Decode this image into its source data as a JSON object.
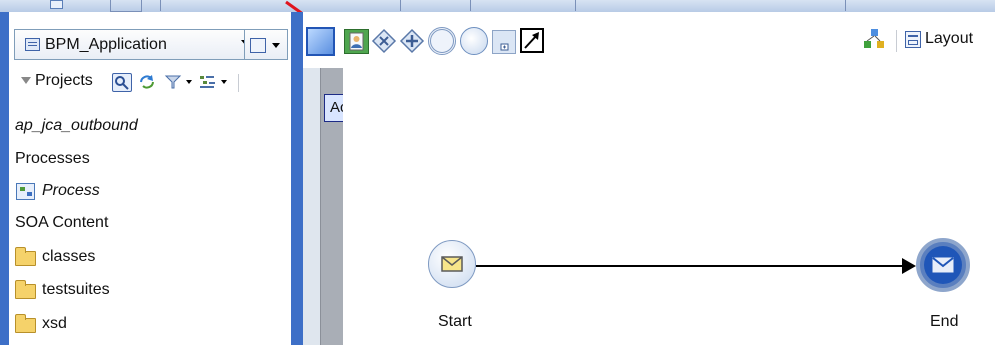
{
  "app_selector": {
    "value": "BPM_Application"
  },
  "projects": {
    "label": "Projects"
  },
  "tree": {
    "items": [
      {
        "label": "ap_jca_outbound",
        "kind": "project"
      },
      {
        "label": "Processes",
        "kind": "folder-header"
      },
      {
        "label": "Process",
        "kind": "process"
      },
      {
        "label": "SOA Content",
        "kind": "folder-header"
      },
      {
        "label": "classes",
        "kind": "folder"
      },
      {
        "label": "testsuites",
        "kind": "folder"
      },
      {
        "label": "xsd",
        "kind": "folder"
      }
    ]
  },
  "toolbar": {
    "tooltip": "Activity",
    "layout_label": "Layout"
  },
  "diagram": {
    "start_label": "Start",
    "end_label": "End"
  },
  "colors": {
    "frame_blue": "#3d6fc7",
    "tooltip_bg": "#d9e5ff",
    "annotation_red": "#e0141e"
  }
}
